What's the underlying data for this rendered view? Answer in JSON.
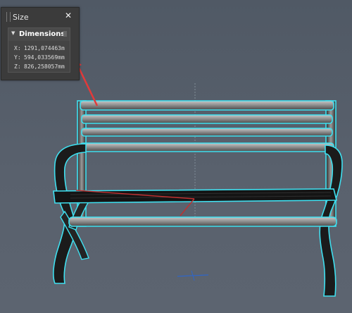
{
  "panel": {
    "title": "Size",
    "close_glyph": "✕",
    "group": {
      "title": "Dimensions",
      "toggle_glyph": "▼",
      "rows": [
        {
          "axis": "X:",
          "value": "1291,074463m"
        },
        {
          "axis": "Y:",
          "value": "594,033569mm"
        },
        {
          "axis": "Z:",
          "value": "826,258057mm"
        }
      ]
    }
  },
  "colors": {
    "selection_outline": "#3fe0f0",
    "annotation_arrow": "#e23a3a",
    "bench_metal": "#8c8c8c",
    "bench_seat": "#1a1a1a"
  },
  "icons": {
    "close": "close-icon",
    "collapse": "collapse-triangle-icon",
    "pin": "pin-icon"
  }
}
